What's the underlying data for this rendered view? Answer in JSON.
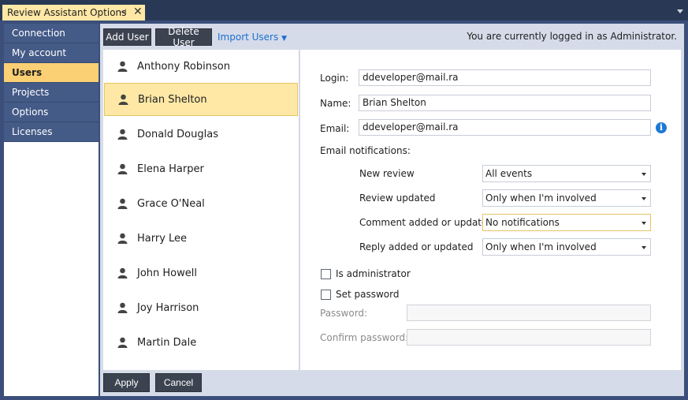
{
  "window": {
    "tab_title": "Review Assistant Options",
    "pin_glyph": "⊣",
    "close_glyph": "✕"
  },
  "nav": {
    "items": [
      {
        "label": "Connection",
        "active": false
      },
      {
        "label": "My account",
        "active": false
      },
      {
        "label": "Users",
        "active": true
      },
      {
        "label": "Projects",
        "active": false
      },
      {
        "label": "Options",
        "active": false
      },
      {
        "label": "Licenses",
        "active": false
      }
    ]
  },
  "toolbar": {
    "add_user": "Add User",
    "delete_user": "Delete User",
    "import_users": "Import Users",
    "import_caret": "▼",
    "status": "You are currently logged in as Administrator."
  },
  "users": [
    {
      "name": "Anthony Robinson",
      "selected": false
    },
    {
      "name": "Brian Shelton",
      "selected": true
    },
    {
      "name": "Donald Douglas",
      "selected": false
    },
    {
      "name": "Elena Harper",
      "selected": false
    },
    {
      "name": "Grace O'Neal",
      "selected": false
    },
    {
      "name": "Harry Lee",
      "selected": false
    },
    {
      "name": "John Howell",
      "selected": false
    },
    {
      "name": "Joy Harrison",
      "selected": false
    },
    {
      "name": "Martin Dale",
      "selected": false
    }
  ],
  "details": {
    "login_label": "Login:",
    "login_value": "ddeveloper@mail.ra",
    "name_label": "Name:",
    "name_value": "Brian Shelton",
    "email_label": "Email:",
    "email_value": "ddeveloper@mail.ra",
    "info_glyph": "i",
    "notifications_heading": "Email notifications:",
    "notifications": [
      {
        "label": "New review",
        "value": "All events"
      },
      {
        "label": "Review updated",
        "value": "Only when I'm involved"
      },
      {
        "label": "Comment added or updated",
        "value": "No notifications"
      },
      {
        "label": "Reply added or updated",
        "value": "Only when I'm involved"
      }
    ],
    "is_admin_label": "Is administrator",
    "is_admin_checked": false,
    "set_password_label": "Set password",
    "set_password_checked": false,
    "password_label": "Password:",
    "password_value": "",
    "confirm_password_label": "Confirm password:",
    "confirm_password_value": ""
  },
  "footer": {
    "apply": "Apply",
    "cancel": "Cancel"
  },
  "colors": {
    "frame": "#3b4f7a",
    "title_bar": "#293955",
    "active_tab": "#ffe8a6",
    "nav_active": "#fbcf74",
    "selection": "#ffe8a6",
    "link": "#1a6fcf",
    "info": "#1c79d5"
  }
}
